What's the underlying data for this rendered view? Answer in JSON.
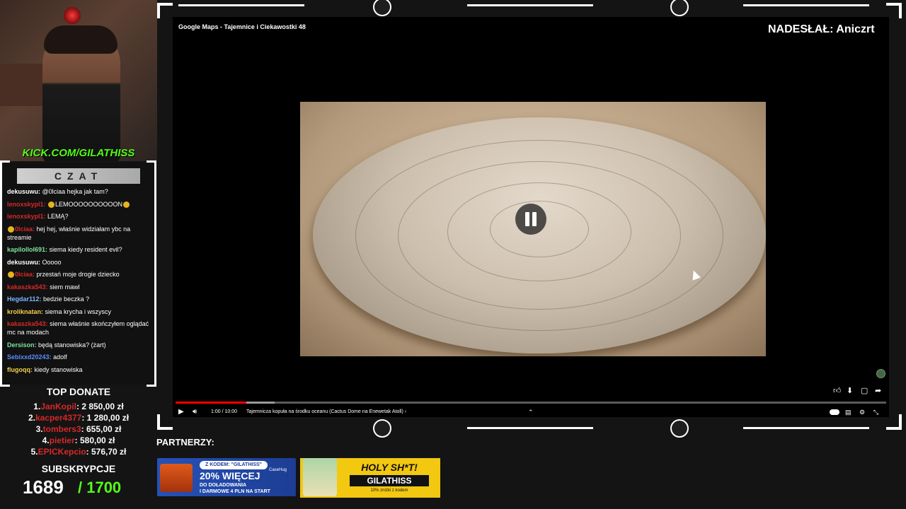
{
  "webcam": {
    "kick_url": "KICK.COM/GILATHISS"
  },
  "chat": {
    "title": "CZAT",
    "messages": [
      {
        "user": "dekusuwu:",
        "text": "@0lciaa hejka jak tam?",
        "color": "#ffffff",
        "emote_before": false
      },
      {
        "user": "lenoxskypl1:",
        "text": "LEMOOOOOOOOOON",
        "color": "#d72828",
        "emote_before": false,
        "emotes_around": true
      },
      {
        "user": "lenoxskypl1:",
        "text": "LEMĄ?",
        "color": "#d72828",
        "emote_before": false
      },
      {
        "user": "0lciaa:",
        "text": "hej hej, właśnie widziałam ybc na streamie",
        "color": "#d72828",
        "emote_before": true
      },
      {
        "user": "kapilollol691:",
        "text": "siema kiedy resident evil?",
        "color": "#7ee2a0",
        "emote_before": false
      },
      {
        "user": "dekusuwu:",
        "text": "Ooooo",
        "color": "#ffffff",
        "emote_before": false
      },
      {
        "user": "0lciaa:",
        "text": "przestań moje drogie dziecko",
        "color": "#d72828",
        "emote_before": true
      },
      {
        "user": "kakaszka543:",
        "text": "siem mawl",
        "color": "#d72828",
        "emote_before": false
      },
      {
        "user": "Hegdar112:",
        "text": "bedzie beczka ?",
        "color": "#7fb6ff",
        "emote_before": false
      },
      {
        "user": "kroliknatan:",
        "text": "siema krycha i wszyscy",
        "color": "#f5d04f",
        "emote_before": false
      },
      {
        "user": "kakaszka543:",
        "text": "siema właśnie skończyłem oglądać mc na modach",
        "color": "#d72828",
        "emote_before": false
      },
      {
        "user": "Dersison:",
        "text": "będą stanowiska? (żart)",
        "color": "#7ee2a0",
        "emote_before": false
      },
      {
        "user": "Sebixxd20243:",
        "text": "adolf",
        "color": "#5b8cff",
        "emote_before": false
      },
      {
        "user": "flugoqq:",
        "text": "kiedy stanowiska",
        "color": "#f5d04f",
        "emote_before": false
      }
    ]
  },
  "top_donate": {
    "title": "TOP DONATE",
    "entries": [
      {
        "rank": "1.",
        "name": "JanKopil",
        "amount": ": 2 850,00 zł"
      },
      {
        "rank": "2.",
        "name": "kacper4377",
        "amount": ": 1 280,00 zł"
      },
      {
        "rank": "3.",
        "name": "tombers3",
        "amount": ": 655,00 zł"
      },
      {
        "rank": "4.",
        "name": "pietier",
        "amount": ": 580,00 zł"
      },
      {
        "rank": "5.",
        "name": "EPICKepcio",
        "amount": ": 576,70 zł"
      }
    ]
  },
  "subscriptions": {
    "title": "SUBSKRYPCJE",
    "count": "1689",
    "goal": "/ 1700"
  },
  "video": {
    "title": "Google Maps - Tajemnice i Ciekawostki 48",
    "sender": "NADESŁAŁ: Aniczrt",
    "time": "1:00 / 10:00",
    "chapter": "Tajemnicza kopuła na środku oceanu (Cactus Dome na Enewetak Atoll)",
    "progress": 0.1,
    "chevron_right": "›",
    "chevron_up": "⌃"
  },
  "partners": {
    "label": "PARTNERZY:",
    "banner1": {
      "code": "Z KODEM: \"GILATHISS\"",
      "headline": "20% WIĘCEJ",
      "line1": "DO DOŁADOWANIA",
      "line2": "I DARMOWE 4 PLN NA START",
      "brand": "CaseHug"
    },
    "banner2": {
      "headline": "HOLY SH*T!",
      "code": "GILATHISS",
      "sub": "10% zniżki z kodem"
    }
  },
  "colors": {
    "kick_green": "#53fc18",
    "chat_red": "#d72828",
    "accent_red": "#ff0000"
  }
}
